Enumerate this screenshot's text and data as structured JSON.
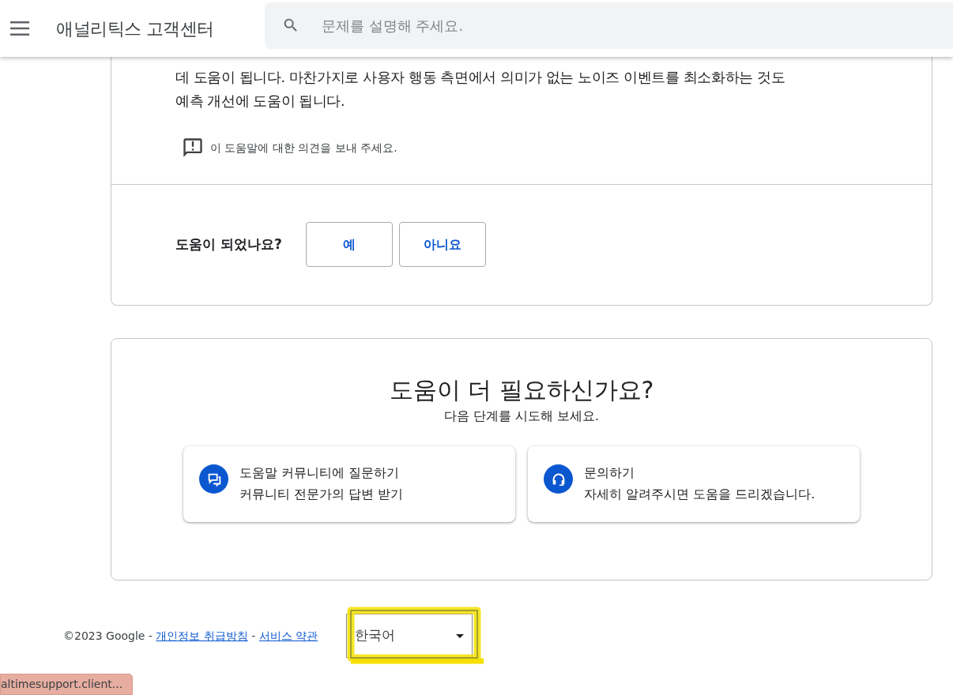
{
  "header": {
    "title": "애널리틱스 고객센터",
    "search": {
      "placeholder": "문제를 설명해 주세요."
    }
  },
  "article": {
    "lines": [
      "데 도움이 됩니다. 마찬가지로 사용자 행동 측면에서 의미가 없는 노이즈 이벤트를 최소화하는 것도",
      "예측 개선에 도움이 됩니다."
    ],
    "feedback_link": "이 도움말에 대한 의견을 보내 주세요."
  },
  "helpful": {
    "question": "도움이 되었나요?",
    "buttons": [
      "예",
      "아니요"
    ]
  },
  "more_help": {
    "title": "도움이 더 필요하신가요?",
    "subtitle": "다음 단계를 시도해 보세요.",
    "options": [
      {
        "kind": "community",
        "title": "도움말 커뮤니티에 질문하기",
        "description": "커뮤니티 전문가의 답변 받기"
      },
      {
        "kind": "contact",
        "title": "문의하기",
        "description": "자세히 알려주시면 도움을 드리겠습니다."
      }
    ]
  },
  "footer": {
    "parts": [
      {
        "kind": "text",
        "text": "©2023 Google -"
      },
      {
        "kind": "link",
        "text": "개인정보 취급방침"
      },
      {
        "kind": "text",
        "text": "-"
      },
      {
        "kind": "link",
        "text": "서비스 약관"
      }
    ],
    "language": "한국어"
  },
  "status_bar": {
    "url": "altimesupport.client..."
  }
}
